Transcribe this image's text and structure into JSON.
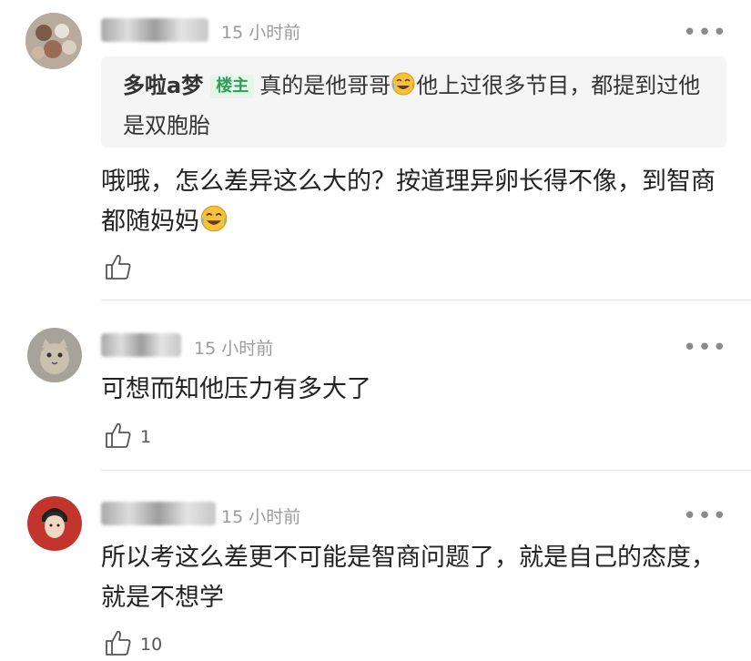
{
  "comments": [
    {
      "time": "15 小时前",
      "quote": {
        "author": "多啦a梦",
        "badge": "楼主",
        "text_a": "真的是他哥哥",
        "text_b": "他上过很多节目，都提到过他是双胞胎"
      },
      "text_a": "哦哦，怎么差异这么大的？按道理异卵长得不像，到智商都随妈妈",
      "likes": ""
    },
    {
      "time": "15 小时前",
      "text": "可想而知他压力有多大了",
      "likes": "1"
    },
    {
      "time": "15 小时前",
      "text": "所以考这么差更不可能是智商问题了，就是自己的态度，就是不想学",
      "likes": "10"
    }
  ],
  "icons": {
    "more": "more-horizontal-icon",
    "like": "thumbs-up-icon",
    "emoji": "laughing-tears-emoji-icon"
  },
  "colors": {
    "badge_text": "#2e9e5a",
    "badge_bg": "#e4f5ea",
    "quote_bg": "#f5f5f5",
    "meta_text": "#9b9b9b"
  }
}
